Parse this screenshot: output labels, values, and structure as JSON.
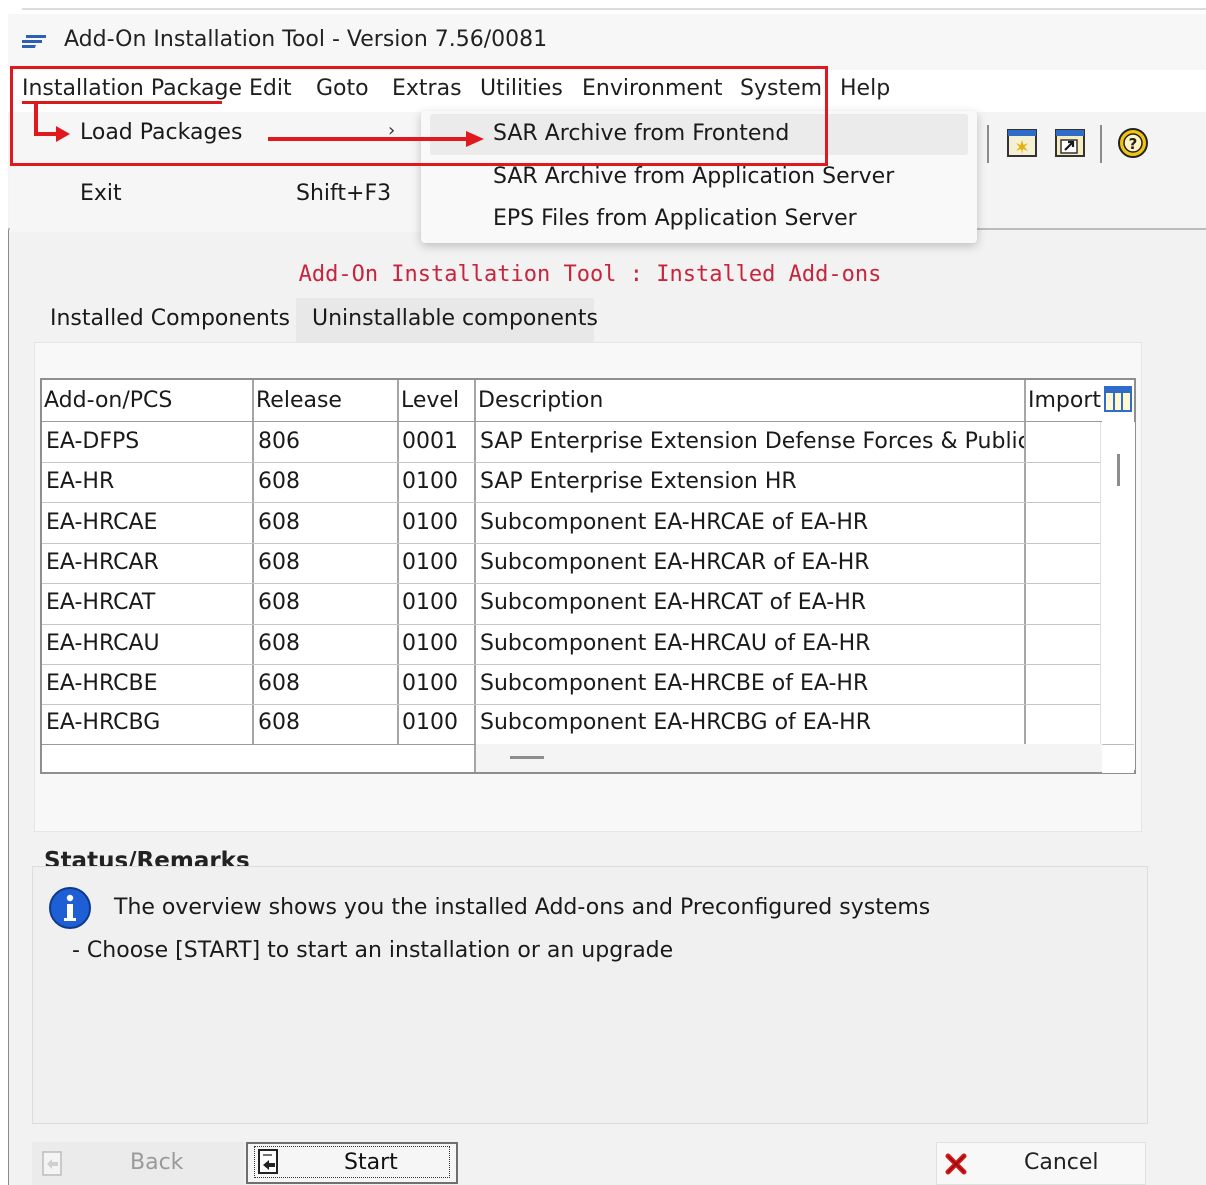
{
  "window": {
    "title": "Add-On Installation Tool - Version 7.56/0081"
  },
  "menubar": {
    "items": [
      "Installation Package",
      "Edit",
      "Goto",
      "Extras",
      "Utilities",
      "Environment",
      "System",
      "Help"
    ]
  },
  "dropdown": {
    "load_packages": "Load Packages",
    "submenu_arrow": "›",
    "exit": "Exit",
    "exit_shortcut": "Shift+F3"
  },
  "submenu": {
    "items": [
      "SAR Archive from Frontend",
      "SAR Archive from Application Server",
      "EPS Files from Application Server"
    ]
  },
  "main": {
    "headline": "Add-On Installation Tool : Installed Add-ons"
  },
  "tabs": [
    {
      "label": "Installed Components",
      "active": true
    },
    {
      "label": "Uninstallable components",
      "active": false
    }
  ],
  "table": {
    "columns": [
      "Add-on/PCS",
      "Release",
      "Level",
      "Description",
      "Import"
    ],
    "rows": [
      [
        "EA-DFPS",
        "806",
        "0001",
        "SAP Enterprise Extension Defense Forces & Public .."
      ],
      [
        "EA-HR",
        "608",
        "0100",
        "SAP Enterprise Extension HR"
      ],
      [
        "EA-HRCAE",
        "608",
        "0100",
        "Subcomponent EA-HRCAE of EA-HR"
      ],
      [
        "EA-HRCAR",
        "608",
        "0100",
        "Subcomponent EA-HRCAR of EA-HR"
      ],
      [
        "EA-HRCAT",
        "608",
        "0100",
        "Subcomponent EA-HRCAT of EA-HR"
      ],
      [
        "EA-HRCAU",
        "608",
        "0100",
        "Subcomponent EA-HRCAU of EA-HR"
      ],
      [
        "EA-HRCBE",
        "608",
        "0100",
        "Subcomponent EA-HRCBE of EA-HR"
      ],
      [
        "EA-HRCBG",
        "608",
        "0100",
        "Subcomponent EA-HRCBG of EA-HR"
      ]
    ]
  },
  "status": {
    "title": "Status/Remarks",
    "line1": "The overview shows you the installed Add-ons and Preconfigured systems",
    "line2": "- Choose [START] to start an installation or an upgrade"
  },
  "buttons": {
    "back": "Back",
    "start": "Start",
    "cancel": "Cancel"
  },
  "colors": {
    "annotation_red": "#e0191f",
    "headline": "#c8243b",
    "info_blue": "#1f5fd6"
  }
}
